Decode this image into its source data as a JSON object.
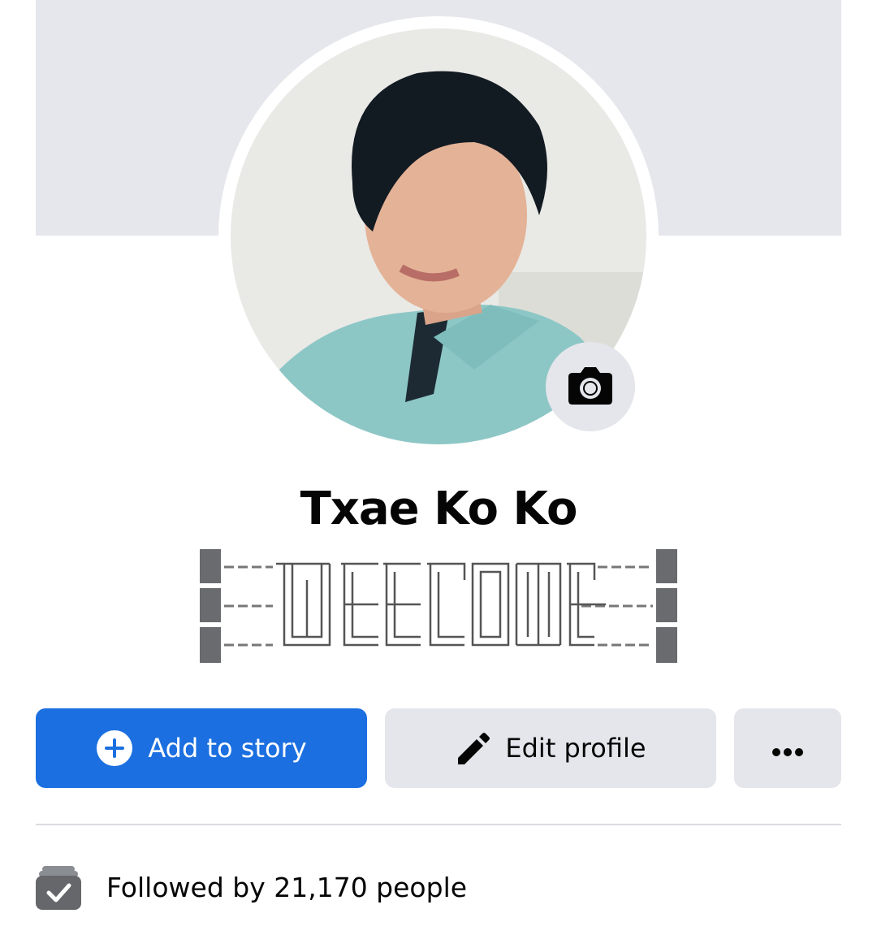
{
  "profile": {
    "name": "Txae Ko Ko",
    "bio_text": "WELCOME",
    "cover_color": "#e6e7ec"
  },
  "camera": {
    "icon": "camera-icon"
  },
  "actions": {
    "add_story_label": "Add to story",
    "add_story_icon": "plus-circle-icon",
    "edit_profile_label": "Edit profile",
    "edit_profile_icon": "pencil-icon",
    "more_icon": "more-dots-icon"
  },
  "followers": {
    "icon": "followers-check-icon",
    "text": "Followed by 21,170 people"
  },
  "colors": {
    "primary": "#1b6fe0",
    "secondary_button": "#e4e6eb",
    "text": "#050505"
  }
}
